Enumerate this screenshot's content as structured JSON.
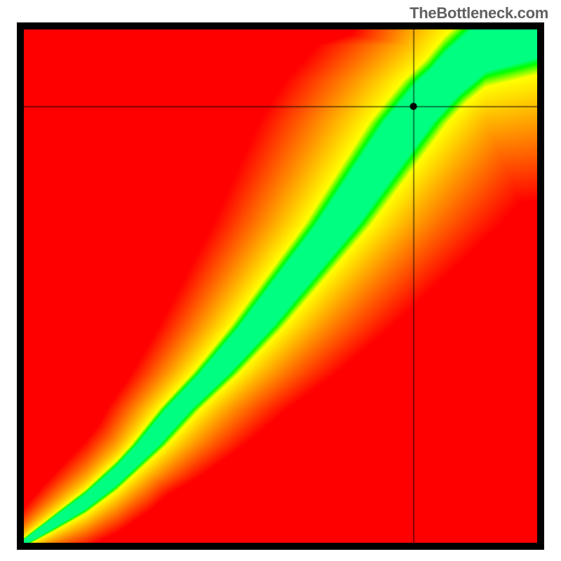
{
  "watermark": "TheBottleneck.com",
  "chart_data": {
    "type": "heatmap",
    "title": "",
    "xlabel": "",
    "ylabel": "",
    "xlim": [
      0,
      1
    ],
    "ylim": [
      0,
      1
    ],
    "crosshair": {
      "x": 0.76,
      "y": 0.85
    },
    "marker": {
      "x": 0.76,
      "y": 0.85
    },
    "ridge": {
      "comment": "center of the green optimal band, normalized coords",
      "points": [
        [
          0.0,
          0.0
        ],
        [
          0.06,
          0.04
        ],
        [
          0.12,
          0.08
        ],
        [
          0.18,
          0.13
        ],
        [
          0.24,
          0.19
        ],
        [
          0.3,
          0.26
        ],
        [
          0.37,
          0.33
        ],
        [
          0.45,
          0.42
        ],
        [
          0.53,
          0.52
        ],
        [
          0.61,
          0.62
        ],
        [
          0.68,
          0.72
        ],
        [
          0.75,
          0.82
        ],
        [
          0.82,
          0.9
        ],
        [
          0.9,
          0.97
        ],
        [
          1.0,
          1.0
        ]
      ]
    },
    "band_half_width": 0.055,
    "grid": false,
    "legend": false
  }
}
